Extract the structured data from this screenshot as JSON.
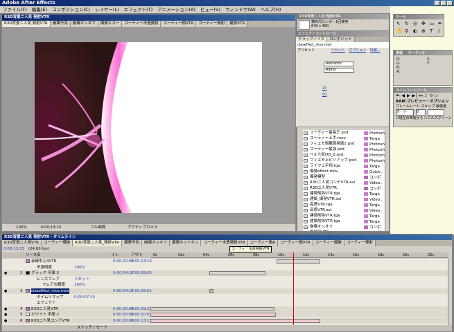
{
  "app": {
    "title": "Adobe After Effects"
  },
  "menu": [
    "ファイル(F)",
    "編集(E)",
    "コンポジション(C)",
    "レイヤー(L)",
    "エフェクト(T)",
    "アニメーション(A)",
    "ビュー(V)",
    "ウィンドウ(W)",
    "ヘルプ(H)"
  ],
  "comp_window": {
    "title": "R3D背景ニ人見 発射VTR",
    "tabs": [
      "R3D背景ニ人見 発射VTR",
      "崩壊予兆",
      "崩壊オンオフ",
      "爆発エコー",
      "コーティー木造発射",
      "コーティー樹VTR",
      "コーティー発射",
      "建設VTR"
    ],
    "bottom": {
      "zoom": "100%",
      "timecode": "0:00:13:15",
      "res": "フル画質",
      "view": "アクティブカメラ"
    }
  },
  "project": {
    "title": "R3D背景ニ人見 発射VTR",
    "info": "横丙尺ロンポ・1回使用",
    "size": "640 x 480",
    "tabs": [
      "プロジェクト",
      "エフェクトコントロール"
    ],
    "items": [
      {
        "name": "コーティー最長王 psd",
        "color": "#c87cc8",
        "type": "Photosh"
      },
      {
        "name": "コーティー上手.mov",
        "color": "#c87cc8",
        "type": "Targa"
      },
      {
        "name": "フィエモ樹展面画面2 psd",
        "color": "#c87cc8",
        "type": "Photosh"
      },
      {
        "name": "コーティー最強 psd",
        "color": "#c87cc8",
        "type": "Photosh"
      },
      {
        "name": "ベル七仮HD_2.psd",
        "color": "#c87cc8",
        "type": "Photosh"
      },
      {
        "name": "フィエモ上ビジアップ psd",
        "color": "#c87cc8",
        "type": "Photosh"
      },
      {
        "name": "ライフ上平用 tga",
        "color": "#c87cc8",
        "type": "Targa"
      },
      {
        "name": "爆発effect.mov",
        "color": "#c87cc8",
        "type": "Quick.."
      },
      {
        "name": "爆発模型",
        "color": "#b070b0",
        "type": "コンポ"
      },
      {
        "name": "R3Dニ人見コンテVTR.avi",
        "color": "#c87cc8",
        "type": "Video.."
      },
      {
        "name": "R3Dニ人見VTR",
        "color": "#b070b0",
        "type": "コンポ"
      },
      {
        "name": "建設削除VTR.tga",
        "color": "#c87cc8",
        "type": "Targa"
      },
      {
        "name": "建設_爆発VTR.avi",
        "color": "#c87cc8",
        "type": "Video.."
      },
      {
        "name": "高塔VTR.tga",
        "color": "#c87cc8",
        "type": "Targa"
      },
      {
        "name": "高塔VTR.avi",
        "color": "#c87cc8",
        "type": "Video.."
      },
      {
        "name": "建設削除VTR.tga",
        "color": "#c87cc8",
        "type": "Targa"
      },
      {
        "name": "建設削除VTR.tga",
        "color": "#c87cc8",
        "type": "Targa"
      },
      {
        "name": "崩壊オンオフ",
        "color": "#b070b0",
        "type": "コンポ"
      },
      {
        "name": "爆破用VTR",
        "color": "#b070b0",
        "type": "コンポ"
      },
      {
        "name": "コーティー上手.tga",
        "color": "#c87cc8",
        "type": "Targa"
      },
      {
        "name": "上下デジタルアップ.psd",
        "color": "#c87cc8",
        "type": "Photosh"
      },
      {
        "name": "崩壊予兆.tga",
        "color": "#c87cc8",
        "type": "Targa"
      },
      {
        "name": "建設用VTR",
        "color": "#b070b0",
        "type": "コンポ"
      }
    ]
  },
  "effect_controls": {
    "title": "エフェクトコントロール",
    "tabs": [
      "グラックノイズ",
      "コンポジット"
    ],
    "file": "claseffect_mov.mov",
    "labels": {
      "preset": "プリセット",
      "tab1": "リセット",
      "tab2": "オプション",
      "tab3": "情報..."
    },
    "dropdown1": "Romantic",
    "dropdown2": "Alpha",
    "val1": "20",
    "val2": "00"
  },
  "tools": {
    "title": "ツール"
  },
  "info": {
    "title": "情報",
    "tab2": "オーディオ",
    "r": "R:",
    "g": "G:",
    "b": "B:",
    "a": "A:",
    "x": "X:",
    "y": "Y:"
  },
  "preview": {
    "title": "タイムコントロール",
    "label": "RAM プレビュー・オプション",
    "framerate": "フレームレート",
    "skip": "スキップ",
    "res": "解像度",
    "fps_val": "0",
    "auto": "オート",
    "from_current": "現在の時間から",
    "fullscreen": "フルスクリーン"
  },
  "timeline": {
    "title": "R3D背景ニ人見 発射VTR・タイムライン",
    "timecode": "0:00:13:15",
    "fps": "(24.00 fps)",
    "tabs": [
      "R3D背景ニ人見VTR",
      "コーティー爆破",
      "R3D背景ニ人見_発射VTR",
      "爆発予兆",
      "崩壊オンオフ",
      "爆発ホットオン",
      "コーティー木造発射VTR",
      "コーティー樹A",
      "コーティー樹VTR",
      "コーティー爆破",
      "コーティー発射"
    ],
    "col_source": "ソース名",
    "col_in": "イン",
    "col_out": "アウト",
    "tooltip": "コーティー木造発射VTR",
    "ruler": [
      "0s",
      "02s",
      "04s",
      "06s",
      "08s",
      "10s",
      "12s",
      "14s",
      "16s",
      "18s",
      "20s",
      "22s"
    ],
    "switch_mode": "スイッチ / モード",
    "layers": [
      {
        "num": "",
        "name": "赤緑中心4VTR",
        "color": "#c87cc8",
        "mode": "",
        "in": "0:00:10:03",
        "out": "0:00:13:15",
        "indent": 0
      },
      {
        "num": "",
        "name": "不透明度",
        "color": "",
        "mode": "100%",
        "in": "",
        "out": "",
        "indent": 1
      },
      {
        "num": "2",
        "name": "グラック 平面 3",
        "color": "#111111",
        "mode": "",
        "in": "0:00:04:17",
        "out": "0:00:09:05",
        "indent": 0
      },
      {
        "num": "",
        "name": "レンズフレア",
        "color": "",
        "mode": "リセット",
        "in": "",
        "out": "",
        "indent": 1
      },
      {
        "num": "",
        "name": "フレアの輝度",
        "color": "",
        "mode": "100%",
        "in": "",
        "out": "",
        "indent": 2
      },
      {
        "num": "3",
        "name": "claseffect_mov.mov",
        "color": "#c87cc8",
        "mode": "",
        "in": "0:00:04:17",
        "out": "0:00:05:01",
        "indent": 0
      },
      {
        "num": "",
        "name": "タイムリマップ",
        "color": "",
        "mode": "0:00:07:10",
        "in": "",
        "out": "",
        "indent": 1
      },
      {
        "num": "",
        "name": "エフェクト",
        "color": "",
        "mode": "",
        "in": "",
        "out": "",
        "indent": 1
      },
      {
        "num": "4",
        "name": "R3Dニ人見VTR",
        "color": "#b070b0",
        "mode": "",
        "in": "0:00:00:00",
        "out": "0:00:09:23",
        "indent": 0
      },
      {
        "num": "5",
        "name": "ホワイト 平面 2",
        "color": "#ffffff",
        "mode": "",
        "in": "0:00:00:00",
        "out": "0:00:10:01",
        "indent": 0
      },
      {
        "num": "6",
        "name": "R3Dニ人見コンテVTR",
        "color": "#c87cc8",
        "mode": "",
        "in": "0:00:00:00",
        "out": "0:00:13:15",
        "indent": 0
      }
    ]
  }
}
